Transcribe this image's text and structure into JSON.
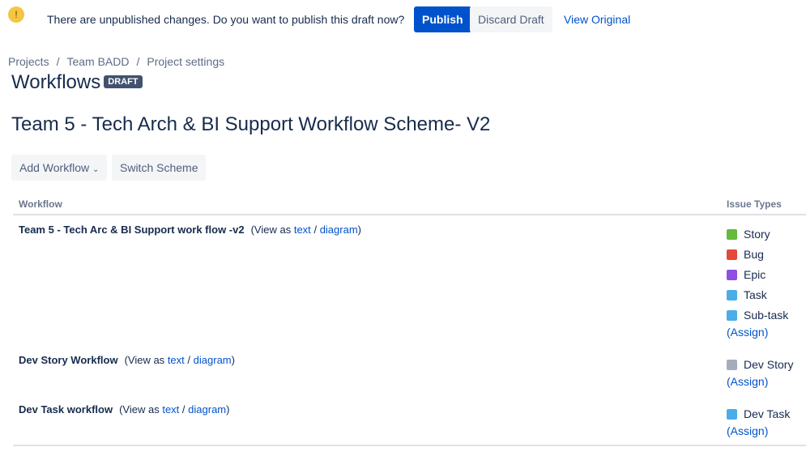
{
  "banner": {
    "message": "There are unpublished changes. Do you want to publish this draft now?",
    "publish": "Publish",
    "discard": "Discard Draft",
    "view_original": "View Original"
  },
  "breadcrumb": [
    "Projects",
    "Team BADD",
    "Project settings"
  ],
  "title": "Workflows",
  "badge": "DRAFT",
  "scheme": "Team 5 - Tech Arch & BI Support Workflow Scheme- V2",
  "toolbar": {
    "add": "Add Workflow",
    "switch": "Switch Scheme"
  },
  "table": {
    "col_workflow": "Workflow",
    "col_types": "Issue Types",
    "view_as": "(View as",
    "text": "text",
    "sep": "/",
    "diagram": "diagram",
    "close": ")",
    "assign": "Assign",
    "rows": [
      {
        "name": "Team 5 - Tech Arc & BI Support work flow -v2",
        "types": [
          {
            "label": "Story",
            "color": "#63ba3c"
          },
          {
            "label": "Bug",
            "color": "#e5493a"
          },
          {
            "label": "Epic",
            "color": "#904ee2"
          },
          {
            "label": "Task",
            "color": "#4bade8"
          },
          {
            "label": "Sub-task",
            "color": "#4bade8"
          }
        ]
      },
      {
        "name": "Dev Story Workflow",
        "types": [
          {
            "label": "Dev Story",
            "color": "#a5adba"
          }
        ]
      },
      {
        "name": "Dev Task workflow",
        "types": [
          {
            "label": "Dev Task",
            "color": "#4bade8"
          }
        ]
      }
    ]
  }
}
